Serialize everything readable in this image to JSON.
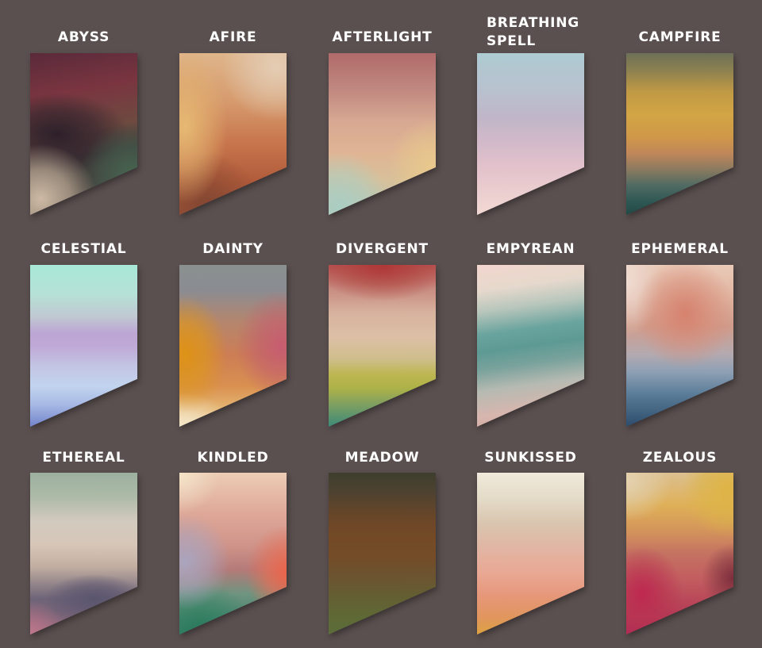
{
  "page": {
    "background_color": "#5b5050",
    "label_color": "#ffffff"
  },
  "swatches": [
    {
      "name": "ABYSS",
      "colors": [
        "#7a3540",
        "#2d202a",
        "#cdb9a5",
        "#46645a"
      ]
    },
    {
      "name": "AFIRE",
      "colors": [
        "#e6b973",
        "#e4cdb4",
        "#c8764d",
        "#94513a"
      ]
    },
    {
      "name": "AFTERLIGHT",
      "colors": [
        "#b06a6a",
        "#d7a892",
        "#e8c88c",
        "#aacdc3"
      ]
    },
    {
      "name": "BREATHING\nSPELL",
      "colors": [
        "#aecbd2",
        "#c0b6c8",
        "#e4c3cc",
        "#f2d9d5"
      ]
    },
    {
      "name": "CAMPFIRE",
      "colors": [
        "#6d7058",
        "#d2a545",
        "#c0875a",
        "#214845"
      ]
    },
    {
      "name": "CELESTIAL",
      "colors": [
        "#a8e8d6",
        "#bca6d4",
        "#c2d4ee",
        "#7384cc"
      ]
    },
    {
      "name": "DAINTY",
      "colors": [
        "#8a9090",
        "#de9216",
        "#c65c70",
        "#f3e6c8"
      ]
    },
    {
      "name": "DIVERGENT",
      "colors": [
        "#b85050",
        "#dcbfa6",
        "#bdb650",
        "#3c8a7a"
      ]
    },
    {
      "name": "EMPYREAN",
      "colors": [
        "#f2d6ce",
        "#5e9a94",
        "#d6b6ae",
        "#d4a8a2"
      ]
    },
    {
      "name": "EPHEMERAL",
      "colors": [
        "#eacab8",
        "#d6826e",
        "#8ea0b4",
        "#2d4c6c"
      ]
    },
    {
      "name": "ETHEREAL",
      "colors": [
        "#9cb0a0",
        "#d6c6b8",
        "#5a556e",
        "#be788c"
      ]
    },
    {
      "name": "KINDLED",
      "colors": [
        "#f5e4c8",
        "#aaa5be",
        "#eb644b",
        "#28785a"
      ]
    },
    {
      "name": "MEADOW",
      "colors": [
        "#3e3e2e",
        "#744a26",
        "#645e32",
        "#5c6c3a"
      ]
    },
    {
      "name": "SUNKISSED",
      "colors": [
        "#f0eadc",
        "#e2b4a2",
        "#e6977a",
        "#dca240"
      ]
    },
    {
      "name": "ZEALOUS",
      "colors": [
        "#e4d2af",
        "#deb446",
        "#be2850",
        "#7d2d3c"
      ]
    }
  ]
}
